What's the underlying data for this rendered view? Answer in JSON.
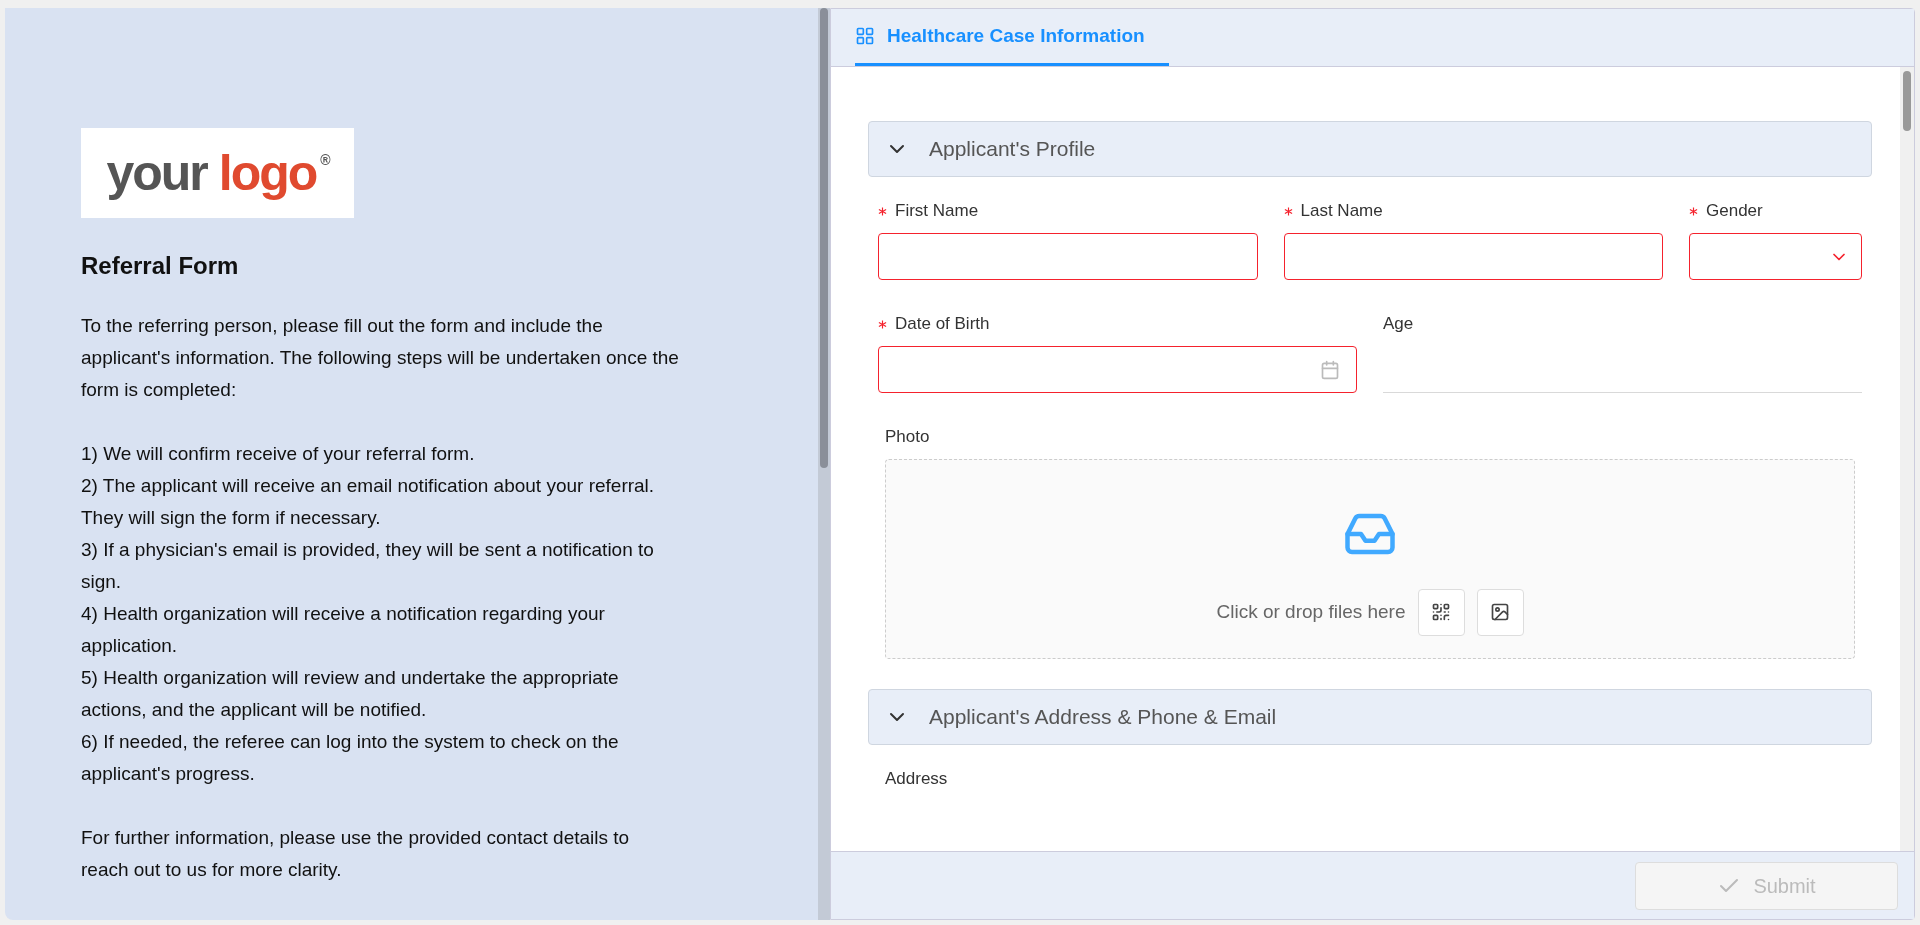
{
  "intro": {
    "logo": {
      "word_1": "your",
      "word_2": "logo",
      "mark": "®"
    },
    "title": "Referral Form",
    "paragraphs": [
      "To the referring person, please fill out the form and include the applicant's information. The following steps will be undertaken once the form is completed:"
    ],
    "steps": [
      "1) We will confirm receive of your referral form.",
      "2) The applicant will receive an email notification about your referral. They will sign the form if necessary.",
      "3) If a physician's email is provided, they will be sent a notification to sign.",
      "4) Health organization will receive a notification regarding your application.",
      "5) Health organization will review and undertake the appropriate actions, and the applicant will be notified.",
      "6) If needed, the referee can log into the system to check on the applicant's progress."
    ],
    "closing": "For further information, please use the provided contact details to reach out to us for more clarity."
  },
  "tabs": [
    {
      "label": "Healthcare Case Information",
      "selected": true
    }
  ],
  "sections": [
    {
      "title": "Applicant's Profile",
      "expanded": true,
      "rows": [
        [
          {
            "label": "First Name",
            "kind": "text",
            "required": true
          },
          {
            "label": "Last Name",
            "kind": "text",
            "required": true
          },
          {
            "label": "Gender",
            "kind": "select",
            "required": true
          }
        ],
        [
          {
            "label": "Date of Birth",
            "kind": "date",
            "required": true
          },
          {
            "label": "Age",
            "kind": "readonly",
            "required": false
          }
        ],
        [
          {
            "label": "Photo",
            "kind": "upload",
            "required": false,
            "hint": "Click or drop files here"
          }
        ]
      ]
    },
    {
      "title": "Applicant's Address & Phone & Email",
      "expanded": true,
      "rows": [
        [
          {
            "label": "Address",
            "kind": "label",
            "required": false
          }
        ]
      ]
    }
  ],
  "footer": {
    "submit": {
      "label": "Submit",
      "disabled": true
    }
  }
}
